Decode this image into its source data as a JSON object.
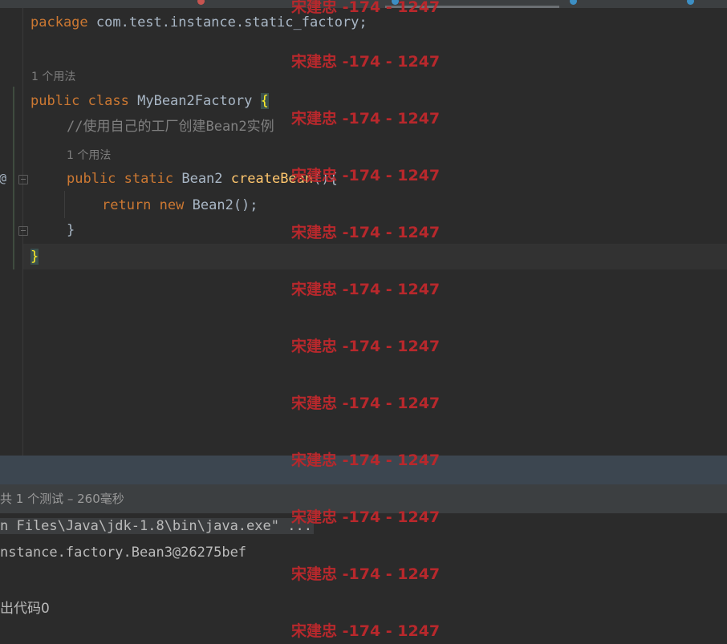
{
  "editor": {
    "package_keyword": "package",
    "package_name": " com.test.instance.static_factory;",
    "usage_hint_class": "1 个用法",
    "public_keyword": "public",
    "class_keyword": "class",
    "class_name": "MyBean2Factory",
    "open_brace": "{",
    "comment": "//使用自己的工厂创建Bean2实例",
    "usage_hint_method": "1 个用法",
    "static_keyword": "static",
    "return_type": "Bean2",
    "method_name": "createBean",
    "method_params": "(){",
    "return_keyword": "return",
    "new_keyword": "new",
    "constructor_call": "Bean2();",
    "method_close": "}",
    "class_close": "}",
    "gutter_marker": "@"
  },
  "run_panel": {
    "summary": "共 1 个测试 – 260毫秒",
    "console": {
      "command": "n Files\\Java\\jdk-1.8\\bin\\java.exe\" ...",
      "output_line": "nstance.factory.Bean3@26275bef",
      "exit_line": "出代码0"
    }
  },
  "watermark": {
    "text": "宋建忠 -174 - 1247",
    "color": "#b8282c"
  },
  "colors": {
    "background": "#2b2b2b",
    "keyword": "#cc7832",
    "function": "#ffc66d",
    "comment": "#808080",
    "text": "#a9b7c6"
  }
}
